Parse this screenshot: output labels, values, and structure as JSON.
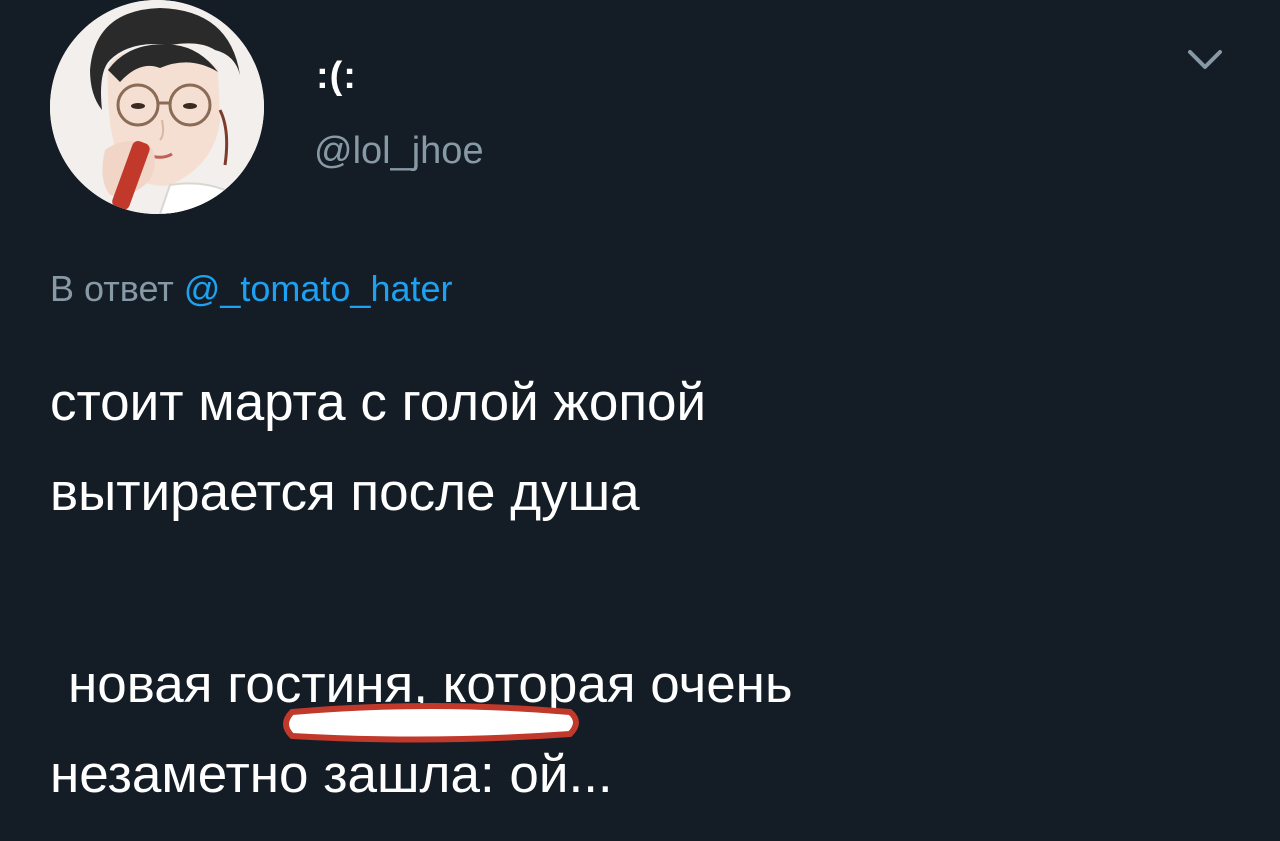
{
  "author": {
    "display_name": ":(:",
    "handle": "@lol_jhoe",
    "avatar": "avatar-illustration-man-glasses-microphone"
  },
  "menu": {
    "icon": "chevron-down-icon"
  },
  "reply": {
    "prefix": "В ответ",
    "mention": "@_tomato_hater"
  },
  "tweet": {
    "lines": [
      "стоит марта с голой жопой",
      "вытирается после душа",
      "новая гостиня, которая очень",
      "незаметно зашла: ой..."
    ]
  },
  "colors": {
    "background": "#141d26",
    "text": "#ffffff",
    "muted": "#8899a6",
    "link": "#1da1f2",
    "underline_mark": "#c0392b"
  }
}
